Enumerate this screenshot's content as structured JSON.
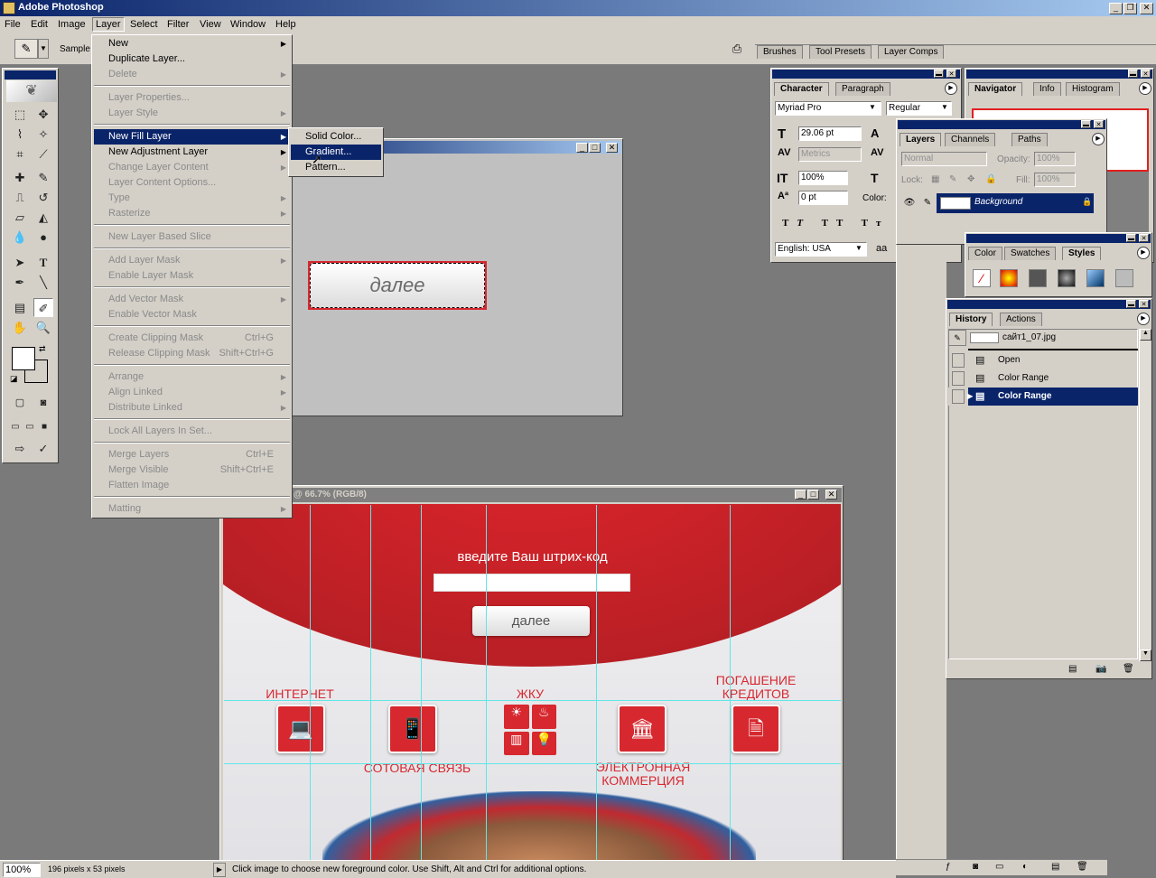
{
  "app": {
    "title": "Adobe Photoshop"
  },
  "menubar": [
    "File",
    "Edit",
    "Image",
    "Layer",
    "Select",
    "Filter",
    "View",
    "Window",
    "Help"
  ],
  "options_bar": {
    "sample_label": "Sample"
  },
  "palette_well": {
    "tabs": [
      "Brushes",
      "Tool Presets",
      "Layer Comps"
    ]
  },
  "layer_menu": {
    "items": [
      {
        "label": "New",
        "disabled": false,
        "submenu": true
      },
      {
        "label": "Duplicate Layer...",
        "disabled": false
      },
      {
        "label": "Delete",
        "disabled": true,
        "submenu": true
      },
      {
        "label": "Layer Properties...",
        "disabled": true
      },
      {
        "label": "Layer Style",
        "disabled": true,
        "submenu": true
      },
      {
        "label": "New Fill Layer",
        "disabled": false,
        "submenu": true,
        "highlight": true
      },
      {
        "label": "New Adjustment Layer",
        "disabled": false,
        "submenu": true
      },
      {
        "label": "Change Layer Content",
        "disabled": true,
        "submenu": true
      },
      {
        "label": "Layer Content Options...",
        "disabled": true
      },
      {
        "label": "Type",
        "disabled": true,
        "submenu": true
      },
      {
        "label": "Rasterize",
        "disabled": true,
        "submenu": true
      },
      {
        "label": "New Layer Based Slice",
        "disabled": true
      },
      {
        "label": "Add Layer Mask",
        "disabled": true,
        "submenu": true
      },
      {
        "label": "Enable Layer Mask",
        "disabled": true
      },
      {
        "label": "Add Vector Mask",
        "disabled": true,
        "submenu": true
      },
      {
        "label": "Enable Vector Mask",
        "disabled": true
      },
      {
        "label": "Create Clipping Mask",
        "disabled": true,
        "shortcut": "Ctrl+G"
      },
      {
        "label": "Release Clipping Mask",
        "disabled": true,
        "shortcut": "Shift+Ctrl+G"
      },
      {
        "label": "Arrange",
        "disabled": true,
        "submenu": true
      },
      {
        "label": "Align Linked",
        "disabled": true,
        "submenu": true
      },
      {
        "label": "Distribute Linked",
        "disabled": true,
        "submenu": true
      },
      {
        "label": "Lock All Layers In Set...",
        "disabled": true
      },
      {
        "label": "Merge Layers",
        "disabled": true,
        "shortcut": "Ctrl+E"
      },
      {
        "label": "Merge Visible",
        "disabled": true,
        "shortcut": "Shift+Ctrl+E"
      },
      {
        "label": "Flatten Image",
        "disabled": true
      },
      {
        "label": "Matting",
        "disabled": true,
        "submenu": true
      }
    ]
  },
  "fill_submenu": {
    "items": [
      "Solid Color...",
      "Gradient...",
      "Pattern..."
    ],
    "highlighted": "Gradient..."
  },
  "small_doc": {
    "button_text": "далее"
  },
  "main_doc": {
    "title": "@ 66.7% (RGB/8)",
    "heading": "введите Ваш штрих-код",
    "button": "далее",
    "services": {
      "internet": "ИНТЕРНЕТ",
      "zhku": "ЖКУ",
      "credit_line1": "ПОГАШЕНИЕ",
      "credit_line2": "КРЕДИТОВ",
      "mobile": "СОТОВАЯ СВЯЗЬ",
      "ecom_line1": "ЭЛЕКТРОННАЯ",
      "ecom_line2": "КОММЕРЦИЯ"
    }
  },
  "character_panel": {
    "tabs": [
      "Character",
      "Paragraph"
    ],
    "font": "Myriad Pro",
    "style": "Regular",
    "size": "29.06 pt",
    "kerning": "Metrics",
    "vscale": "100%",
    "baseline": "0 pt",
    "color_label": "Color:",
    "language": "English: USA"
  },
  "navigator_panel": {
    "tabs": [
      "Navigator",
      "Info",
      "Histogram"
    ]
  },
  "layers_panel": {
    "tabs": [
      "Layers",
      "Channels",
      "Paths"
    ],
    "blend": "Normal",
    "opacity_label": "Opacity:",
    "opacity": "100%",
    "lock_label": "Lock:",
    "fill_label": "Fill:",
    "fill": "100%",
    "layer_name": "Background"
  },
  "styles_panel": {
    "tabs": [
      "Color",
      "Swatches",
      "Styles"
    ]
  },
  "history_panel": {
    "tabs": [
      "History",
      "Actions"
    ],
    "snapshot": "сайт1_07.jpg",
    "states": [
      "Open",
      "Color Range",
      "Color Range"
    ]
  },
  "status": {
    "zoom": "100%",
    "doc_info": "196 pixels x 53 pixels",
    "hint": "Click image to choose new foreground color.  Use Shift, Alt and Ctrl for additional options."
  },
  "colors": {
    "titlebar": "#0a246a",
    "brand_red": "#d7282f",
    "chrome": "#d4d0c8",
    "guide": "#5fe6e6"
  }
}
